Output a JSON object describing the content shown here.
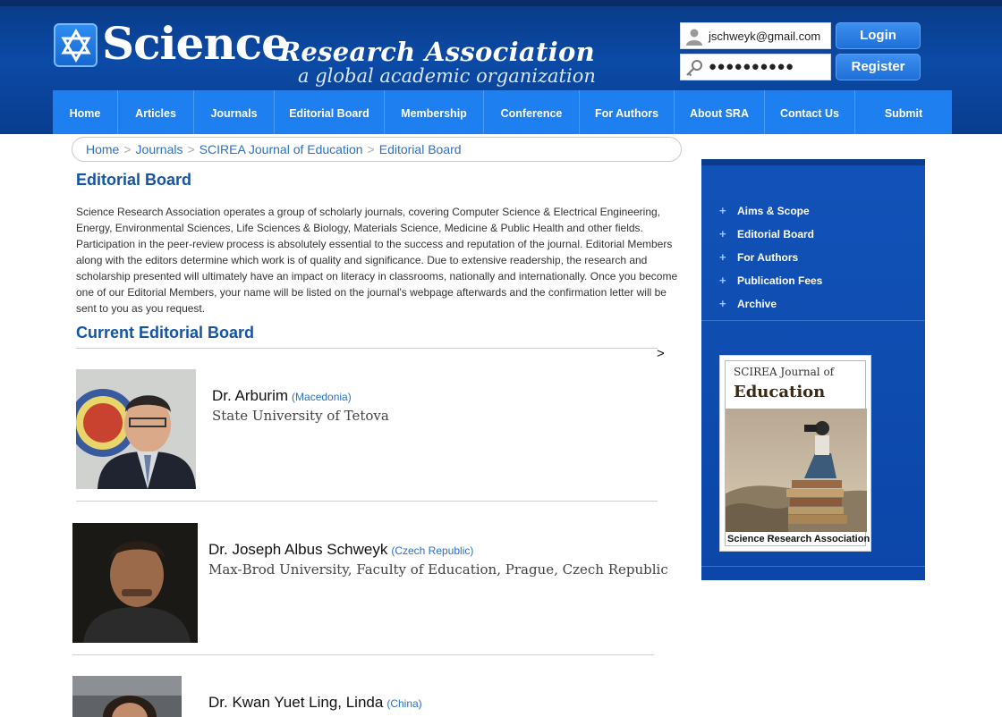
{
  "header": {
    "brand_science": "Science",
    "brand_ra": "Research Association",
    "tagline": "a global academic organization",
    "email_value": "jschweyk@gmail.com",
    "password_value": "●●●●●●●●●●",
    "login_label": "Login",
    "register_label": "Register"
  },
  "nav": [
    {
      "label": "Home"
    },
    {
      "label": "Articles"
    },
    {
      "label": "Journals"
    },
    {
      "label": "Editorial Board"
    },
    {
      "label": "Membership"
    },
    {
      "label": "Conference"
    },
    {
      "label": "For Authors"
    },
    {
      "label": "About SRA"
    },
    {
      "label": "Contact Us"
    },
    {
      "label": "Submit"
    }
  ],
  "breadcrumb": {
    "items": [
      "Home",
      "Journals",
      "SCIREA Journal of Education",
      "Editorial Board"
    ],
    "separator": ">"
  },
  "main": {
    "title": "Editorial Board",
    "intro": "Science Research Association operates a group of scholarly journals, covering Computer Science & Electrical Engineering, Energy, Environmental Sciences, Life Sciences & Biology, Materials Science, Medicine & Public Health and other fields. Participation in the peer-review process is absolutely essential to the success and reputation of the journal. Editorial Members along with the editors determine which work is of quality and significance. Due to extensive readership, the research and scholarship presented will ultimately have an impact on literacy in classrooms, nationally and internationally. Once you become one of our Editorial Members, your name will be listed on the journal's webpage afterwards and the confirmation letter will be sent to you as you request.",
    "section_title": "Current Editorial Board",
    "scroll_arrow": ">",
    "members": [
      {
        "name": "Dr. Arburim",
        "country": "(Macedonia)",
        "affiliation": "State University of Tetova"
      },
      {
        "name": "Dr. Joseph Albus Schweyk",
        "country": "(Czech Republic)",
        "affiliation": "Max-Brod University, Faculty of Education, Prague, Czech Republic"
      },
      {
        "name": "Dr. Kwan Yuet Ling, Linda",
        "country": "(China)",
        "affiliation": ""
      }
    ]
  },
  "sidebar": {
    "items": [
      {
        "label": "Aims & Scope"
      },
      {
        "label": "Editorial Board"
      },
      {
        "label": "For Authors"
      },
      {
        "label": "Publication Fees"
      },
      {
        "label": "Archive"
      }
    ],
    "cover": {
      "line1": "SCIREA Journal of",
      "line2": "Education",
      "publisher": "Science Research Association"
    }
  },
  "colors": {
    "header_bg": "#0b4aa6",
    "nav_bg": "#1e7ff0",
    "link": "#2a70c7",
    "heading": "#1554a4",
    "sidebar_bg": "#1252b8"
  },
  "icons": {
    "logo": "star-of-david-icon",
    "email_field": "user-icon",
    "password_field": "key-icon",
    "sidebar_bullet": "plus-icon"
  }
}
